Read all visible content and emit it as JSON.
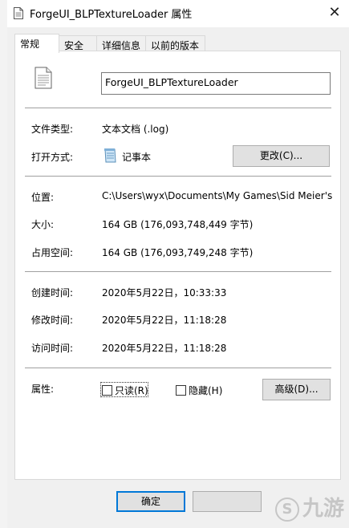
{
  "window": {
    "title": "ForgeUI_BLPTextureLoader 属性",
    "close_glyph": "✕"
  },
  "tabs": [
    {
      "label": "常规"
    },
    {
      "label": "安全"
    },
    {
      "label": "详细信息"
    },
    {
      "label": "以前的版本"
    }
  ],
  "general": {
    "file_name": "ForgeUI_BLPTextureLoader",
    "type_label": "文件类型:",
    "type_value": "文本文档 (.log)",
    "open_with_label": "打开方式:",
    "open_with_value": "记事本",
    "change_button": "更改(C)...",
    "location_label": "位置:",
    "location_value": "C:\\Users\\wyx\\Documents\\My Games\\Sid Meier's",
    "size_label": "大小:",
    "size_value": "164 GB (176,093,748,449 字节)",
    "size_on_disk_label": "占用空间:",
    "size_on_disk_value": "164 GB (176,093,749,248 字节)",
    "created_label": "创建时间:",
    "created_value": "2020年5月22日，10:33:33",
    "modified_label": "修改时间:",
    "modified_value": "2020年5月22日，11:18:28",
    "accessed_label": "访问时间:",
    "accessed_value": "2020年5月22日，11:18:28",
    "attributes_label": "属性:",
    "readonly_label": "只读(R)",
    "hidden_label": "隐藏(H)",
    "advanced_button": "高级(D)..."
  },
  "footer": {
    "ok_button": "确定"
  },
  "watermark": {
    "text": "九游"
  },
  "icons": {
    "title": "document-icon",
    "file": "document-icon",
    "open_with": "notepad-icon"
  }
}
